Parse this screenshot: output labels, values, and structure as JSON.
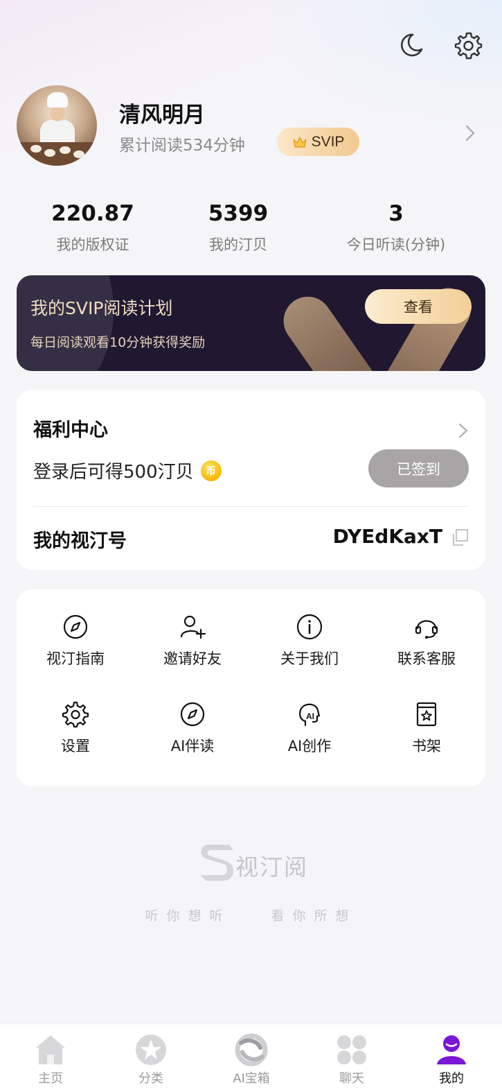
{
  "header": {
    "icons": [
      "moon-icon",
      "settings-icon"
    ]
  },
  "profile": {
    "username": "清风明月",
    "read_total": "累计阅读534分钟",
    "badge": "SVIP"
  },
  "stats": [
    {
      "value": "220.87",
      "label": "我的版权证"
    },
    {
      "value": "5399",
      "label": "我的汀贝"
    },
    {
      "value": "3",
      "label": "今日听读(分钟)"
    }
  ],
  "svip_banner": {
    "title": "我的SVIP阅读计划",
    "subtitle": "每日阅读观看10分钟获得奖励",
    "button": "查看"
  },
  "welfare": {
    "title": "福利中心",
    "desc": "登录后可得500汀贝",
    "coin_glyph": "币",
    "button": "已签到",
    "account_label": "我的视汀号",
    "account_value": "DYEdKaxT"
  },
  "grid": [
    {
      "label": "视汀指南",
      "icon": "compass-icon"
    },
    {
      "label": "邀请好友",
      "icon": "add-user-icon"
    },
    {
      "label": "关于我们",
      "icon": "info-icon"
    },
    {
      "label": "联系客服",
      "icon": "headset-icon"
    },
    {
      "label": "设置",
      "icon": "settings-icon"
    },
    {
      "label": "AI伴读",
      "icon": "compass-icon"
    },
    {
      "label": "AI创作",
      "icon": "ai-head-icon"
    },
    {
      "label": "书架",
      "icon": "bookshelf-icon"
    }
  ],
  "brand": {
    "name": "视汀阅",
    "slogan_left": "听你想听",
    "slogan_right": "看你所想"
  },
  "nav": [
    {
      "label": "主页",
      "icon": "home-icon"
    },
    {
      "label": "分类",
      "icon": "star-icon"
    },
    {
      "label": "AI宝箱",
      "icon": "ai-box-icon"
    },
    {
      "label": "聊天",
      "icon": "chat-clover-icon"
    },
    {
      "label": "我的",
      "icon": "profile-icon",
      "active": true
    }
  ],
  "colors": {
    "accent": "#7b16d8",
    "svip_gold": "#f3c88f",
    "banner_bg": "#1f1830",
    "signed_gray": "#a7a5a6"
  }
}
